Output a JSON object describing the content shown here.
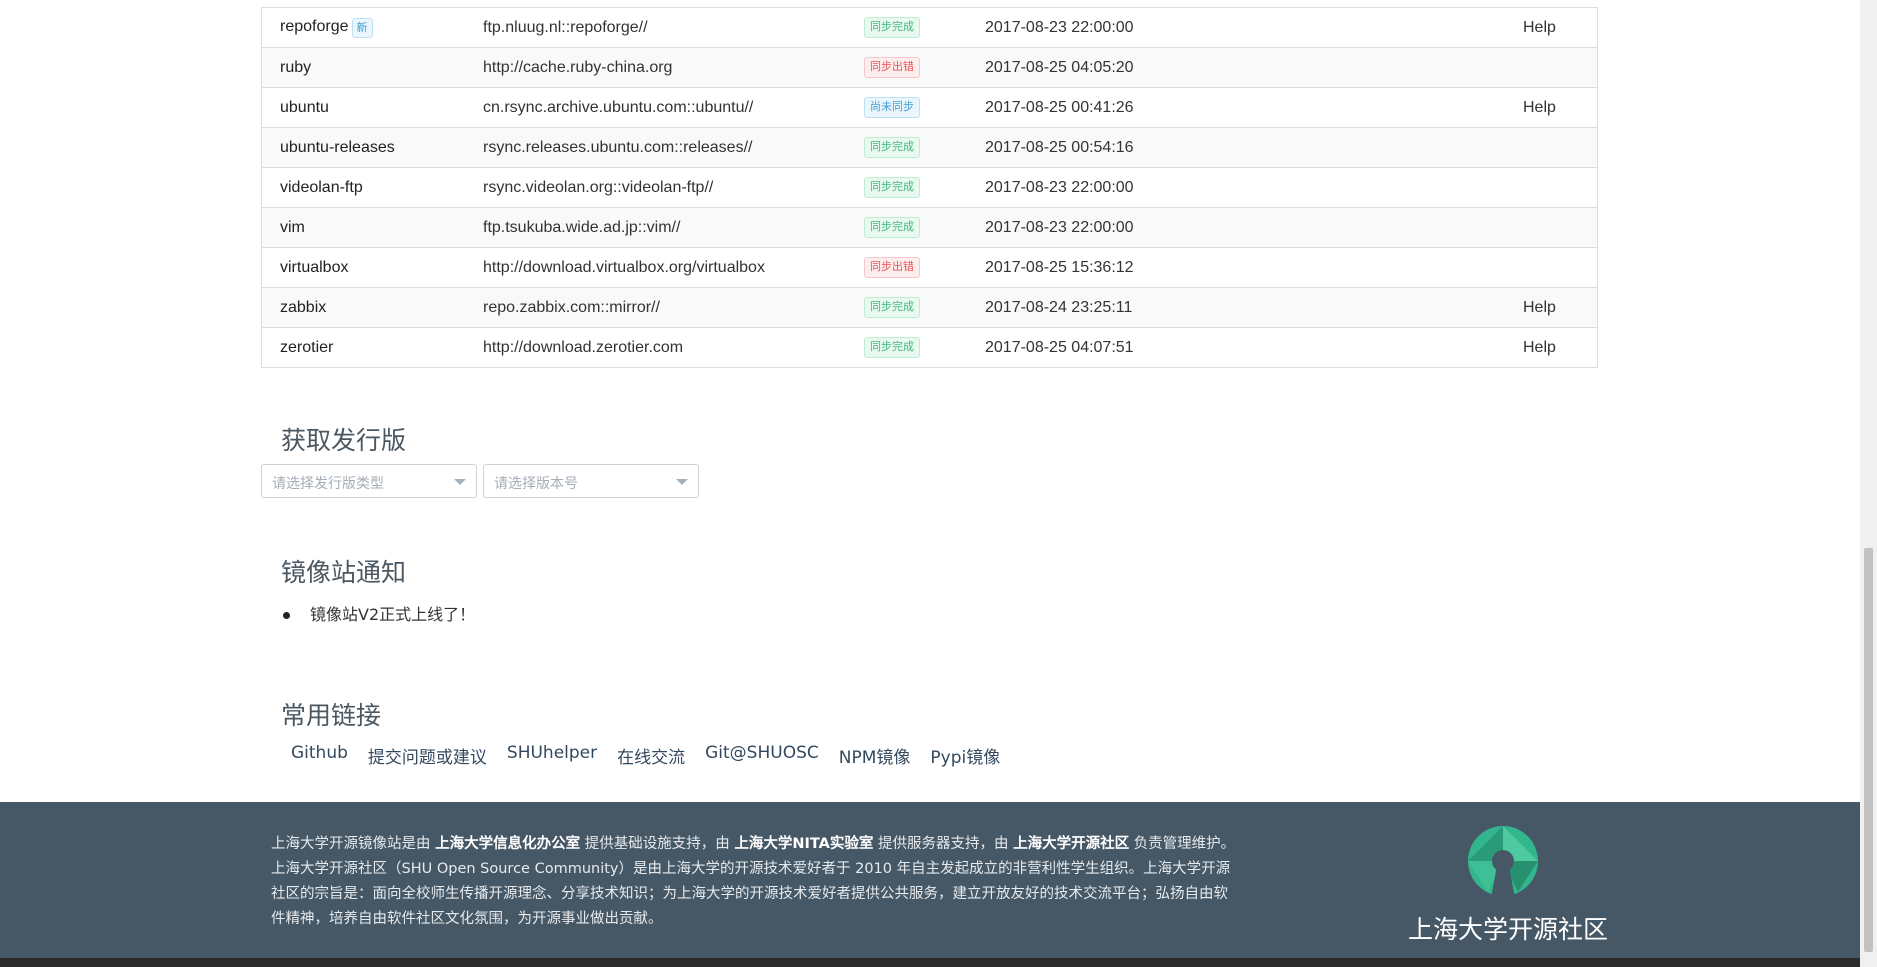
{
  "mirrors": [
    {
      "name": "repoforge",
      "new_tag": "新",
      "url": "ftp.nluug.nl::repoforge//",
      "status": "同步完成",
      "status_type": "success",
      "time": "2017-08-23 22:00:00",
      "help": "Help"
    },
    {
      "name": "ruby",
      "url": "http://cache.ruby-china.org",
      "status": "同步出错",
      "status_type": "error",
      "time": "2017-08-25 04:05:20",
      "help": ""
    },
    {
      "name": "ubuntu",
      "url": "cn.rsync.archive.ubuntu.com::ubuntu//",
      "status": "尚未同步",
      "status_type": "pending",
      "time": "2017-08-25 00:41:26",
      "help": "Help"
    },
    {
      "name": "ubuntu-releases",
      "url": "rsync.releases.ubuntu.com::releases//",
      "status": "同步完成",
      "status_type": "success",
      "time": "2017-08-25 00:54:16",
      "help": ""
    },
    {
      "name": "videolan-ftp",
      "url": "rsync.videolan.org::videolan-ftp//",
      "status": "同步完成",
      "status_type": "success",
      "time": "2017-08-23 22:00:00",
      "help": ""
    },
    {
      "name": "vim",
      "url": "ftp.tsukuba.wide.ad.jp::vim//",
      "status": "同步完成",
      "status_type": "success",
      "time": "2017-08-23 22:00:00",
      "help": ""
    },
    {
      "name": "virtualbox",
      "url": "http://download.virtualbox.org/virtualbox",
      "status": "同步出错",
      "status_type": "error",
      "time": "2017-08-25 15:36:12",
      "help": ""
    },
    {
      "name": "zabbix",
      "url": "repo.zabbix.com::mirror//",
      "status": "同步完成",
      "status_type": "success",
      "time": "2017-08-24 23:25:11",
      "help": "Help"
    },
    {
      "name": "zerotier",
      "url": "http://download.zerotier.com",
      "status": "同步完成",
      "status_type": "success",
      "time": "2017-08-25 04:07:51",
      "help": "Help"
    }
  ],
  "status_colors": {
    "success": "#3fbb7a",
    "error": "#e8555a",
    "pending": "#3ea0d8"
  },
  "release": {
    "title": "获取发行版",
    "distro_placeholder": "请选择发行版类型",
    "version_placeholder": "请选择版本号"
  },
  "notice": {
    "title": "镜像站通知",
    "items": [
      "镜像站V2正式上线了！"
    ]
  },
  "links": {
    "title": "常用链接",
    "items": [
      "Github",
      "提交问题或建议",
      "SHUhelper",
      "在线交流",
      "Git@SHUOSC",
      "NPM镜像",
      "Pypi镜像"
    ]
  },
  "footer": {
    "line1_prefix": "上海大学开源镜像站是由 ",
    "org1": "上海大学信息化办公室",
    "line1_mid1": " 提供基础设施支持，由 ",
    "org2": "上海大学NITA实验室",
    "line1_mid2": " 提供服务器支持，由 ",
    "org3": "上海大学开源社区",
    "line1_suffix": " 负责管理维护。",
    "description": "上海大学开源社区（SHU Open Source Community）是由上海大学的开源技术爱好者于 2010 年自主发起成立的非营利性学生组织。上海大学开源社区的宗旨是：面向全校师生传播开源理念、分享技术知识；为上海大学的开源技术爱好者提供公共服务，建立开放友好的技术交流平台；弘扬自由软件精神，培养自由软件社区文化氛围，为开源事业做出贡献。",
    "logo_text": "上海大学开源社区",
    "logo_icon": "open-source-keyhole-logo",
    "background": "#465866"
  }
}
